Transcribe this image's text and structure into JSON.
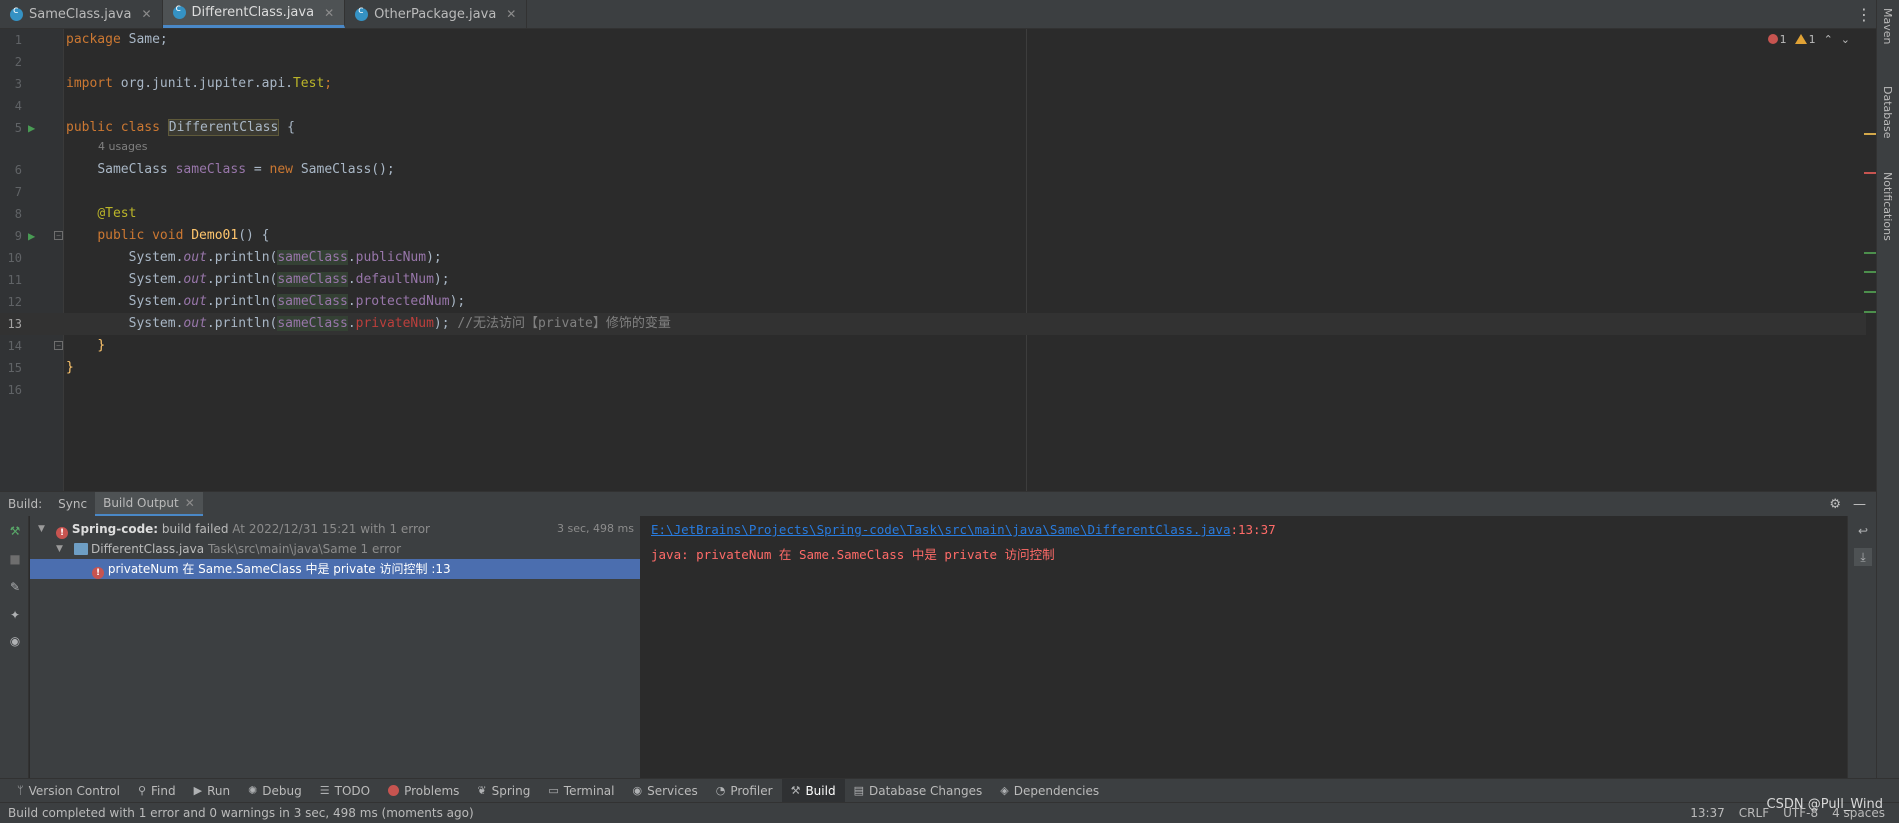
{
  "tabs": [
    {
      "label": "SameClass.java",
      "active": false
    },
    {
      "label": "DifferentClass.java",
      "active": true
    },
    {
      "label": "OtherPackage.java",
      "active": false
    }
  ],
  "right_stripe": {
    "maven": "Maven",
    "database": "Database",
    "notifications": "Notifications"
  },
  "editor": {
    "inspection": {
      "errors": "1",
      "warnings": "1"
    },
    "usages_hint": "4 usages",
    "line_numbers": [
      "1",
      "2",
      "3",
      "4",
      "5",
      "6",
      "7",
      "8",
      "9",
      "10",
      "11",
      "12",
      "13",
      "14",
      "15",
      "16"
    ],
    "code": {
      "l1_kw": "package",
      "l1_rest": " Same;",
      "l3_kw": "import",
      "l3_rest": " org.junit.jupiter.api.",
      "l3_test": "Test",
      "l3_end": ";",
      "l5_kw": "public class",
      "l5_cls": "DifferentClass",
      "l5_end": " {",
      "l6_type": "SameClass ",
      "l6_var": "sameClass",
      "l6_eq": " = ",
      "l6_new": "new",
      "l6_rest": " SameClass();",
      "l8_ann": "@Test",
      "l9_kw": "public void",
      "l9_meth": "Demo01",
      "l9_end": "() {",
      "sys": "System.",
      "out": "out",
      "println": ".println(",
      "obj": "sameClass",
      "dot": ".",
      "f_public": "publicNum",
      "f_default": "defaultNum",
      "f_protected": "protectedNum",
      "f_private": "privateNum",
      "close": ");",
      "l13_comment": "//无法访问【private】修饰的变量",
      "l14": "}",
      "l15": "}"
    }
  },
  "build": {
    "label": "Build:",
    "tabs": [
      "Sync",
      "Build Output"
    ],
    "tree": {
      "root_project": "Spring-code:",
      "root_status": " build failed",
      "root_meta": " At 2022/12/31 15:21 with 1 error",
      "root_duration": "3 sec, 498 ms",
      "file_name": "DifferentClass.java",
      "file_meta": " Task\\src\\main\\java\\Same 1 error",
      "error_item": "privateNum 在 Same.SameClass 中是 private 访问控制 :13"
    },
    "console": {
      "path": "E:\\JetBrains\\Projects\\Spring-code\\Task\\src\\main\\java\\Same\\DifferentClass.java",
      "pos": ":13:37",
      "message": "java: privateNum 在 Same.SameClass 中是 private 访问控制"
    }
  },
  "bottom_tabs": [
    {
      "label": "Version Control",
      "icon": "version-control-icon",
      "glyph": "ᛘ"
    },
    {
      "label": "Find",
      "icon": "search-icon",
      "glyph": "⚲"
    },
    {
      "label": "Run",
      "icon": "run-icon",
      "glyph": "▶"
    },
    {
      "label": "Debug",
      "icon": "bug-icon",
      "glyph": "✺"
    },
    {
      "label": "TODO",
      "icon": "list-icon",
      "glyph": "☰"
    },
    {
      "label": "Problems",
      "icon": "problems-icon",
      "glyph": ""
    },
    {
      "label": "Spring",
      "icon": "spring-leaf-icon",
      "glyph": "❦"
    },
    {
      "label": "Terminal",
      "icon": "terminal-icon",
      "glyph": "▭"
    },
    {
      "label": "Services",
      "icon": "services-icon",
      "glyph": "◉"
    },
    {
      "label": "Profiler",
      "icon": "profiler-icon",
      "glyph": "◔"
    },
    {
      "label": "Build",
      "icon": "hammer-icon",
      "glyph": "⚒"
    },
    {
      "label": "Database Changes",
      "icon": "database-changes-icon",
      "glyph": "▤"
    },
    {
      "label": "Dependencies",
      "icon": "dependencies-icon",
      "glyph": "◈"
    }
  ],
  "status": {
    "message": "Build completed with 1 error and 0 warnings in 3 sec, 498 ms (moments ago)",
    "position": "13:37",
    "line_sep": "CRLF",
    "encoding": "UTF-8",
    "indent": "4 spaces",
    "watermark": "CSDN @Pull_Wind"
  },
  "colors": {
    "accent": "#4a88c7",
    "error": "#c75450",
    "selection": "#4b6eaf"
  }
}
